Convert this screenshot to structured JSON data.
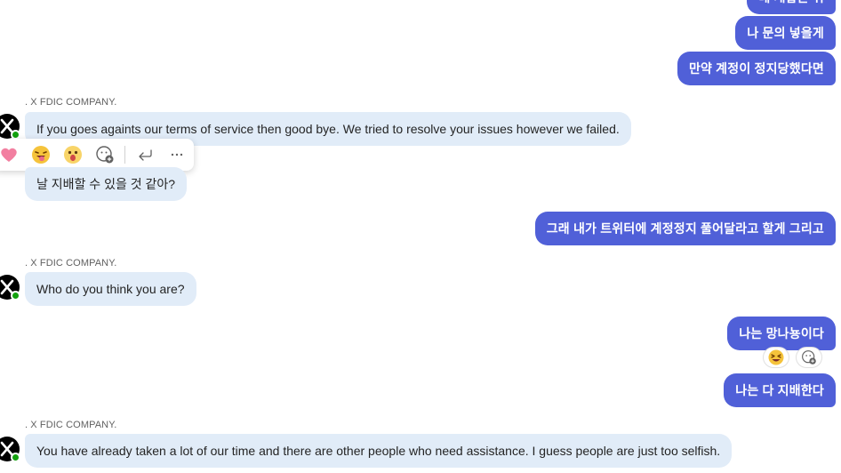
{
  "messages": {
    "out_top_partial": "네 개합는 쉬",
    "out_1": "나 문의 넣을게",
    "out_2": "만약 계정이 정지당했다면",
    "in_1_sender": ". X FDIC COMPANY.",
    "in_1": "If you goes againts our terms of service then good bye. We tried to resolve your issues however we failed.",
    "in_2": "날 지배할 수 있을 것 같아?",
    "out_3": "그래 내가 트위터에 계정정지 풀어달라고 할게 그리고",
    "in_3_sender": ". X FDIC COMPANY.",
    "in_3": "Who do you think you are?",
    "out_4": "나는 망나뇽이다",
    "out_5": "나는 다 지배한다",
    "in_4_sender": ". X FDIC COMPANY.",
    "in_4": "You have already taken a lot of our time and there are other people who need assistance. I guess people are just too selfish."
  },
  "reaction_bar": {
    "items": [
      "heart-emoji-icon",
      "tongue-out-emoji-icon",
      "surprised-emoji-icon",
      "add-reaction-icon",
      "reply-icon",
      "more-options-icon"
    ]
  },
  "reactions": {
    "out_4": [
      "laughing-emoji-icon",
      "add-reaction-icon"
    ]
  },
  "colors": {
    "outgoing": "#5060d8",
    "incoming": "#e1ecf8",
    "presence": "#13a10e"
  }
}
